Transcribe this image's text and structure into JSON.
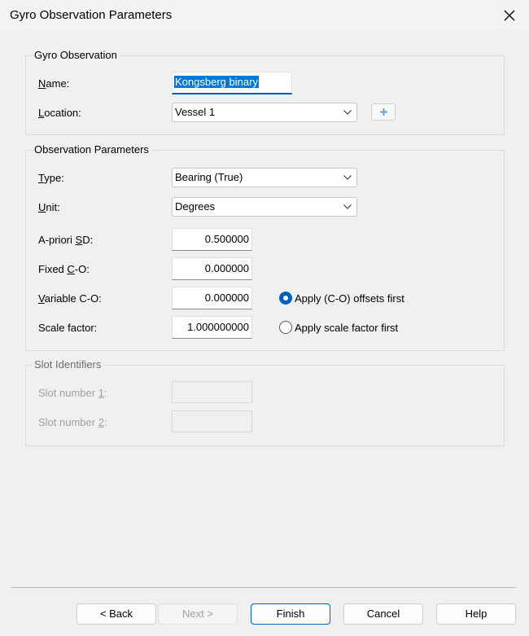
{
  "window": {
    "title": "Gyro Observation Parameters"
  },
  "gyro": {
    "title": "Gyro Observation",
    "name_label": "Name:",
    "name_value": "Kongsberg binary",
    "location_label": "Location:",
    "location_value": "Vessel 1"
  },
  "obs": {
    "title": "Observation Parameters",
    "type_label": "Type:",
    "type_value": "Bearing (True)",
    "unit_label": "Unit:",
    "unit_value": "Degrees",
    "sd_label": "A-priori SD:",
    "sd_value": "0.500000",
    "fixed_label": "Fixed C-O:",
    "fixed_value": "0.000000",
    "variable_label": "Variable C-O:",
    "variable_value": "0.000000",
    "scale_label": "Scale factor:",
    "scale_value": "1.000000000",
    "radio1": "Apply (C-O) offsets first",
    "radio2": "Apply scale factor first"
  },
  "slots": {
    "title": "Slot Identifiers",
    "slot1_label": "Slot number 1:",
    "slot2_label": "Slot number 2:"
  },
  "buttons": {
    "back": "< Back",
    "next": "Next >",
    "finish": "Finish",
    "cancel": "Cancel",
    "help": "Help"
  },
  "colors": {
    "accent": "#005fb8",
    "selection": "#0078d7"
  }
}
